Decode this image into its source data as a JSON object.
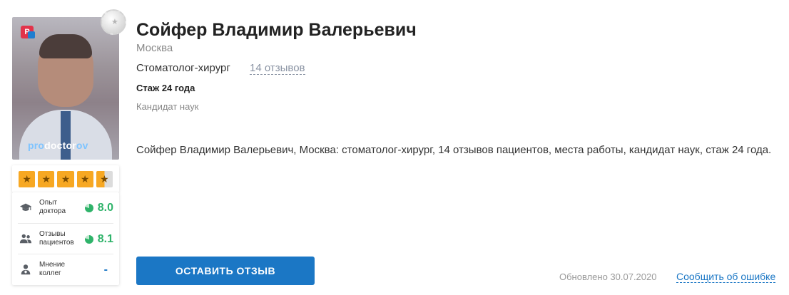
{
  "doctor": {
    "name": "Сойфер Владимир Валерьевич",
    "city": "Москва",
    "specialty": "Стоматолог-хирург",
    "reviews_link": "14 отзывов",
    "experience": "Стаж 24 года",
    "degree": "Кандидат наук",
    "description": "Сойфер Владимир Валерьевич, Москва: стоматолог-хирург, 14 отзывов пациентов, места работы, кандидат наук, стаж 24 года."
  },
  "photo": {
    "watermark_pre": "pro",
    "watermark_mid": "doctor",
    "watermark_post": "ov"
  },
  "rating": {
    "stars_filled": 4,
    "stars_half": 1,
    "stars_total": 5
  },
  "scores": [
    {
      "label": "Опыт доктора",
      "value": "8.0",
      "icon": "graduation-cap-icon"
    },
    {
      "label": "Отзывы пациентов",
      "value": "8.1",
      "icon": "people-icon"
    },
    {
      "label": "Мнение коллег",
      "value": "-",
      "icon": "doctor-icon"
    }
  ],
  "actions": {
    "leave_review": "ОСТАВИТЬ ОТЗЫВ",
    "updated": "Обновлено 30.07.2020",
    "report_error": "Сообщить об ошибке"
  },
  "colors": {
    "accent": "#1b77c5",
    "score_green": "#2fb36a",
    "star_orange": "#f7a823"
  }
}
